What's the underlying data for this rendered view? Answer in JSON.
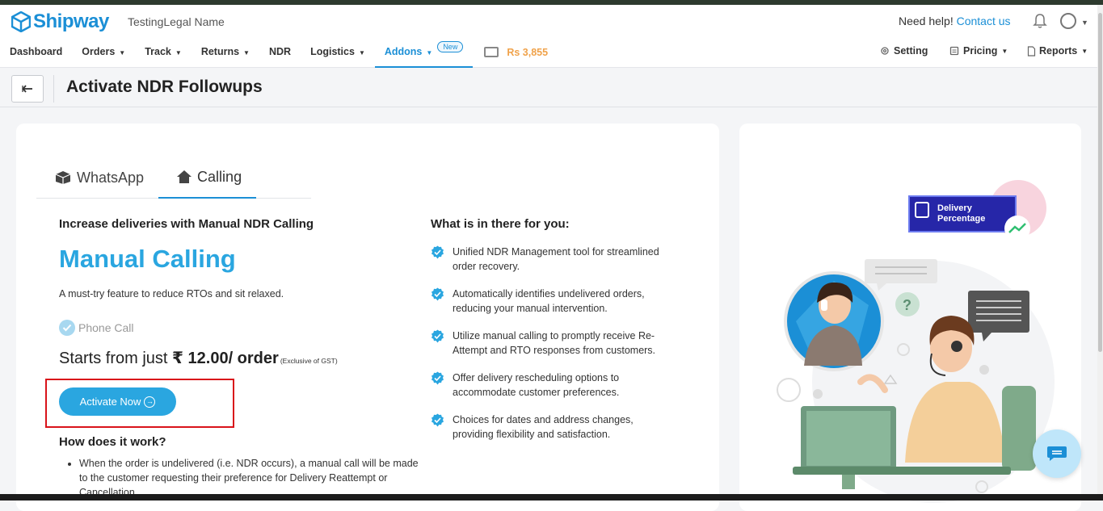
{
  "app": {
    "brand": "Shipway",
    "company": "TestingLegal Name"
  },
  "header": {
    "help_text": "Need help!",
    "contact_link": "Contact us"
  },
  "nav": {
    "items": [
      {
        "label": "Dashboard",
        "caret": false
      },
      {
        "label": "Orders",
        "caret": true
      },
      {
        "label": "Track",
        "caret": true
      },
      {
        "label": "Returns",
        "caret": true
      },
      {
        "label": "NDR",
        "caret": false
      },
      {
        "label": "Logistics",
        "caret": true
      },
      {
        "label": "Addons",
        "caret": true,
        "active": true,
        "badge": "New"
      }
    ],
    "wallet_amount": "Rs 3,855",
    "right": [
      {
        "label": "Setting",
        "icon": "gear-icon"
      },
      {
        "label": "Pricing",
        "icon": "tag-icon"
      },
      {
        "label": "Reports",
        "icon": "document-icon"
      }
    ]
  },
  "page": {
    "title": "Activate NDR Followups"
  },
  "tabs": [
    {
      "label": "WhatsApp",
      "icon": "box-icon"
    },
    {
      "label": "Calling",
      "icon": "home-icon",
      "active": true
    }
  ],
  "left": {
    "subtitle": "Increase deliveries with Manual NDR Calling",
    "title": "Manual Calling",
    "description": "A must-try feature to reduce RTOs and sit relaxed.",
    "feature": "Phone Call",
    "price_prefix": "Starts from just",
    "price_value": "₹ 12.00/ order",
    "price_note": "(Exclusive of GST)",
    "activate_label": "Activate Now",
    "how_title": "How does it work?",
    "how_items": [
      "When the order is undelivered (i.e. NDR occurs), a manual call will be made to the customer requesting their preference for Delivery Reattempt or Cancellation."
    ]
  },
  "right": {
    "title": "What is in there for you:",
    "benefits": [
      "Unified NDR Management tool for streamlined order recovery.",
      "Automatically identifies undelivered orders, reducing your manual intervention.",
      "Utilize manual calling to promptly receive Re-Attempt and RTO responses from customers.",
      "Offer delivery rescheduling options to accommodate customer preferences.",
      "Choices for dates and address changes, providing flexibility and satisfaction."
    ]
  },
  "illustration": {
    "card_line1": "Delivery",
    "card_line2": "Percentage",
    "question_mark": "?"
  },
  "colors": {
    "brand": "#1b8fd6",
    "accent": "#2aa6e0",
    "wallet": "#f0a24a",
    "highlight": "#d9131a"
  }
}
